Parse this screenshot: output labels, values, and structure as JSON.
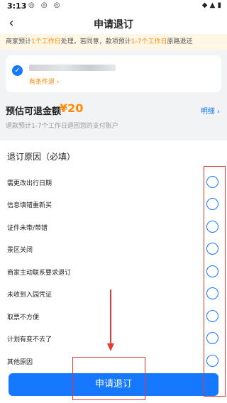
{
  "status_bar": {
    "time": "3:13",
    "app_icons": "◎ ◎ ◎",
    "right_icons": "◆ ▲ ▮"
  },
  "nav": {
    "back_icon": "‹",
    "title": "申请退订"
  },
  "notice": {
    "part1": "商家预计",
    "hl1": "1个工作日",
    "part2": "处理，若同意，款项预计",
    "hl2": "1-7个工作日",
    "part3": "原路退还"
  },
  "item": {
    "check_icon": "✓",
    "policy": "有条件退 ›"
  },
  "refund": {
    "label": "预估可退金额",
    "amount": "¥20",
    "detail_link": "明细 ›",
    "note": "退款预计1-7个工作日退回您的支付账户"
  },
  "reasons": {
    "title": "退订原因（必填）",
    "options": [
      "需更改出行日期",
      "信息填错重新买",
      "证件未带/带错",
      "景区关闭",
      "商家主动联系要求退订",
      "未收到入园凭证",
      "取票不方便",
      "计划有变不去了",
      "其他原因"
    ]
  },
  "submit": {
    "label": "申请退订"
  },
  "colors": {
    "accent": "#1677ff",
    "highlight": "#ff8a00",
    "annotation": "#e53935"
  }
}
